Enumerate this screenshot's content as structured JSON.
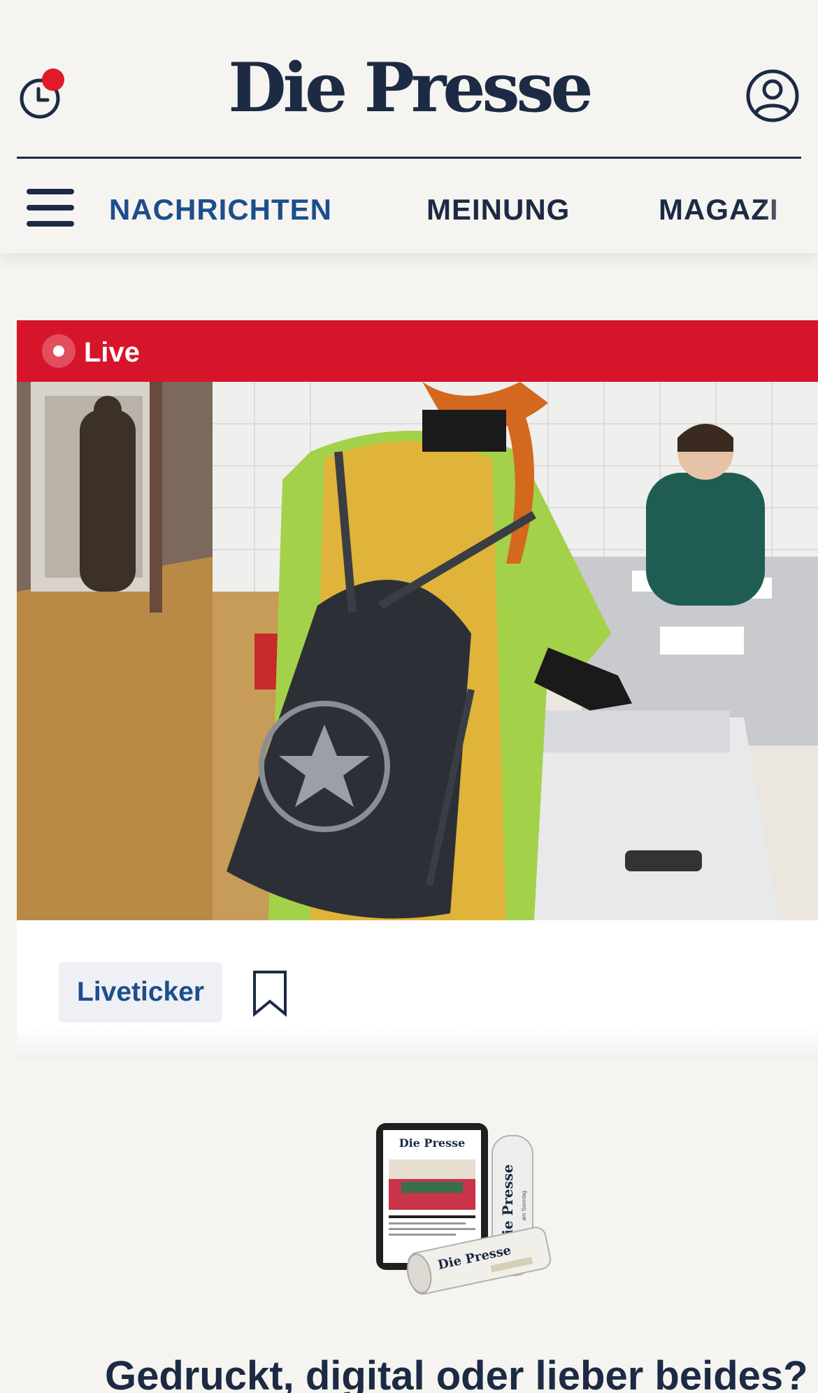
{
  "header": {
    "brand": "Die Presse",
    "icons": {
      "history": "clock-icon",
      "account": "user-circle-icon"
    },
    "notification_dot": true
  },
  "nav": {
    "menu_icon": "hamburger-menu-icon",
    "items": [
      {
        "label": "NACHRICHTEN",
        "active": true
      },
      {
        "label": "MEINUNG",
        "active": false
      },
      {
        "label": "MAGAZI",
        "active": false
      }
    ]
  },
  "article": {
    "live_label": "Live",
    "tag": "Liveticker",
    "bookmark_icon": "bookmark-icon"
  },
  "promo": {
    "title": "Gedruckt, digital oder lieber beides?",
    "art": {
      "tablet_brand": "Die Presse",
      "paper_brand": "Die Presse",
      "roll_brand": "Die Presse",
      "roll_sub": "am Sonntag"
    }
  },
  "colors": {
    "brand_navy": "#1c2a44",
    "active_blue": "#1c4e8c",
    "live_red": "#d7152a",
    "notification_red": "#e01a2b",
    "background": "#f5f4f0"
  }
}
